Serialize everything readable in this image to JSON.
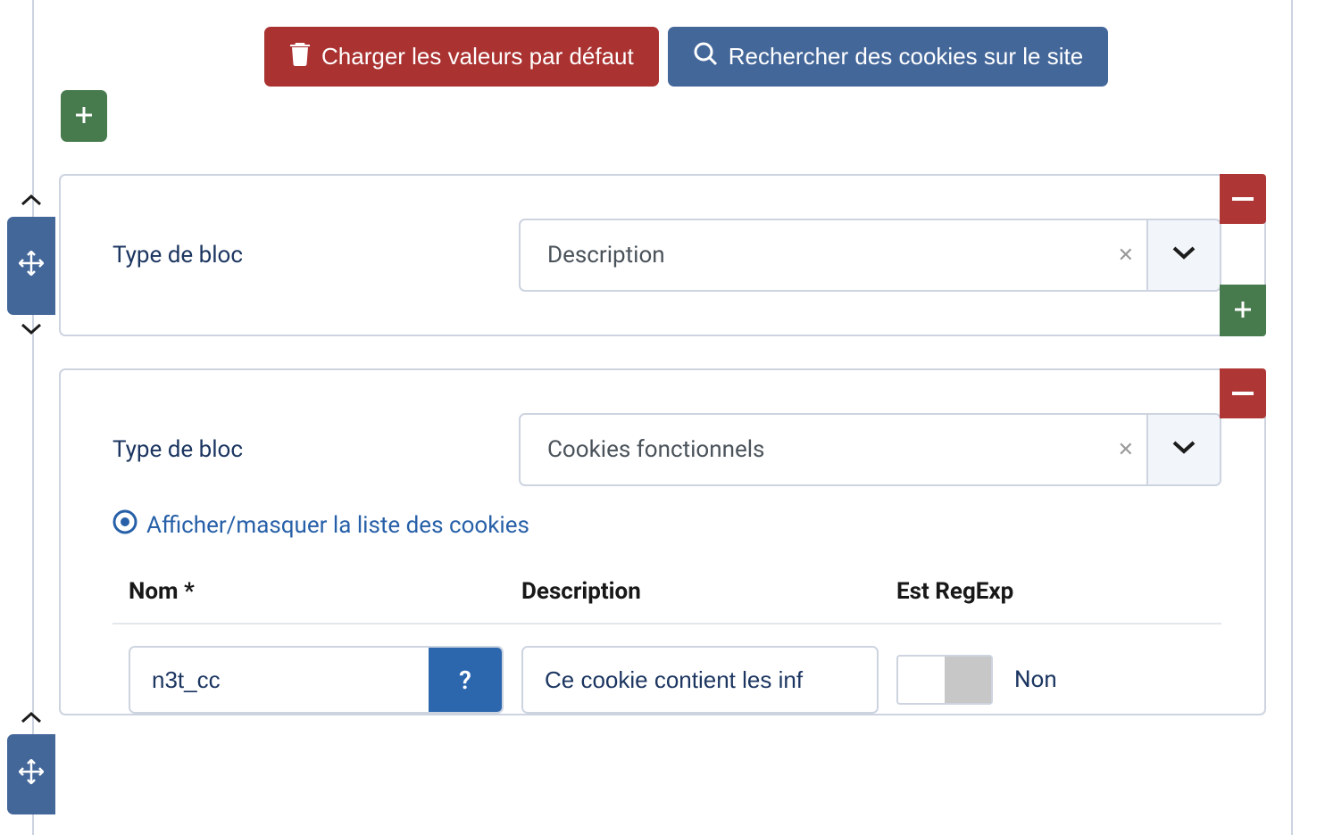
{
  "actions": {
    "load_defaults": "Charger les valeurs par défaut",
    "search_cookies": "Rechercher des cookies sur le site"
  },
  "block1": {
    "label": "Type de bloc",
    "select_value": "Description"
  },
  "block2": {
    "label": "Type de bloc",
    "select_value": "Cookies fonctionnels",
    "toggle_label": "Afficher/masquer la liste des cookies",
    "table": {
      "col_name": "Nom *",
      "col_desc": "Description",
      "col_regex": "Est RegExp",
      "row1": {
        "name": "n3t_cc",
        "help": "?",
        "desc": "Ce cookie contient les inf",
        "regex_state": "Non"
      }
    }
  }
}
